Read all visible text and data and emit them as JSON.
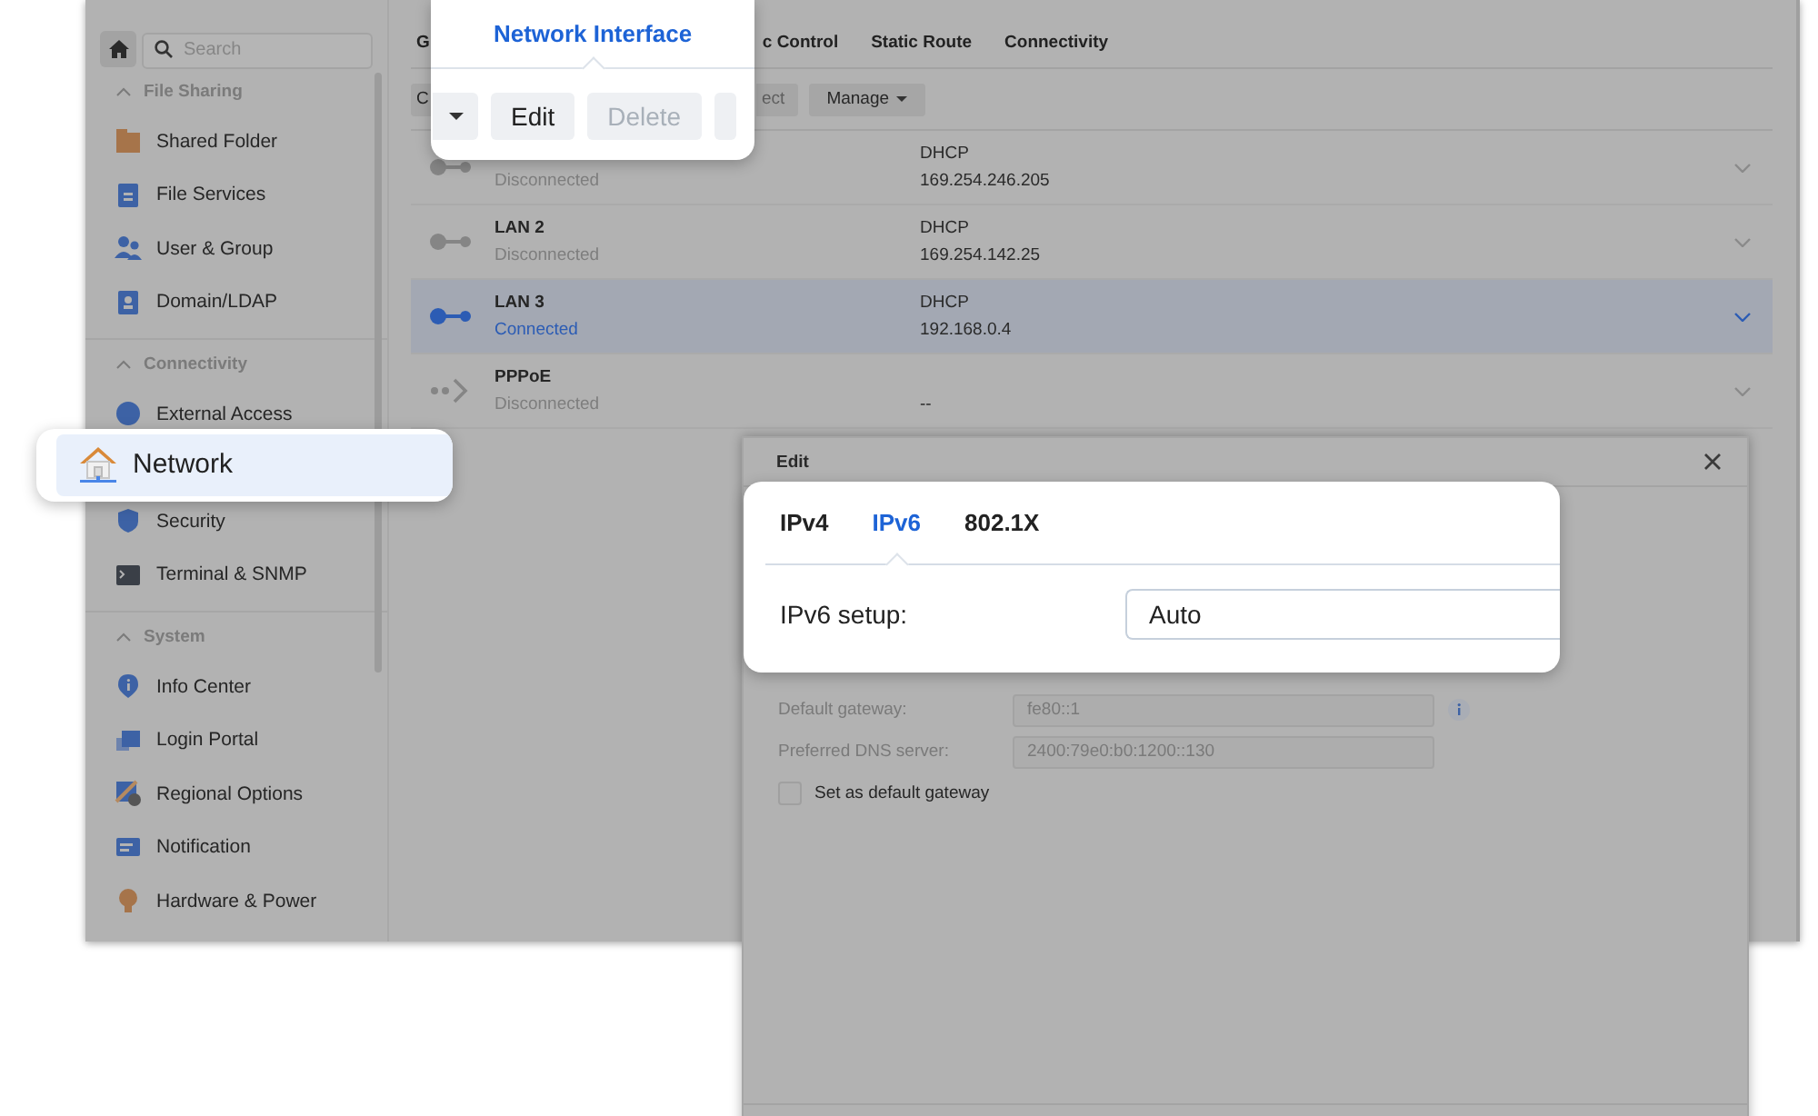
{
  "window": {
    "sidebar": {
      "search": {
        "placeholder": "Search"
      },
      "sections": [
        {
          "title": "File Sharing",
          "expanded": true,
          "items": [
            {
              "label": "Shared Folder",
              "selected": false
            },
            {
              "label": "File Services",
              "selected": false
            },
            {
              "label": "User & Group",
              "selected": false
            },
            {
              "label": "Domain/LDAP",
              "selected": false
            }
          ]
        },
        {
          "title": "Connectivity",
          "expanded": true,
          "items": [
            {
              "label": "External Access",
              "selected": false
            },
            {
              "label": "Network",
              "selected": true,
              "zoomed": true
            },
            {
              "label": "Security",
              "selected": false
            },
            {
              "label": "Terminal & SNMP",
              "selected": false
            }
          ]
        },
        {
          "title": "System",
          "expanded": true,
          "items": [
            {
              "label": "Info Center",
              "selected": false
            },
            {
              "label": "Login Portal",
              "selected": false
            },
            {
              "label": "Regional Options",
              "selected": false
            },
            {
              "label": "Notification",
              "selected": false
            },
            {
              "label": "Hardware & Power",
              "selected": false
            }
          ]
        }
      ]
    },
    "tabs": [
      {
        "label": "G"
      },
      {
        "label": "c Control"
      },
      {
        "label": "Static Route"
      },
      {
        "label": "Connectivity"
      }
    ],
    "toolbar": [
      {
        "label": "C",
        "disabled": false
      },
      {
        "label": "ect",
        "disabled": true
      },
      {
        "label": "Manage",
        "disabled": false,
        "dropdown": true
      }
    ],
    "interfaces": [
      {
        "kind": "lan",
        "status": "Disconnected",
        "connected": false,
        "mode": "DHCP",
        "address": "169.254.246.205",
        "selected": false
      },
      {
        "kind": "lan",
        "name": "LAN 2",
        "status": "Disconnected",
        "connected": false,
        "mode": "DHCP",
        "address": "169.254.142.25",
        "selected": false
      },
      {
        "kind": "lan",
        "name": "LAN 3",
        "status": "Connected",
        "connected": true,
        "mode": "DHCP",
        "address": "192.168.0.4",
        "selected": true
      },
      {
        "kind": "pppoe",
        "name": "PPPoE",
        "status": "Disconnected",
        "connected": false,
        "address": "--",
        "selected": false
      }
    ]
  },
  "toolbar_zoom": {
    "title": "Network Interface",
    "buttons": [
      {
        "kind": "caret"
      },
      {
        "kind": "text",
        "label": "Edit",
        "disabled": false
      },
      {
        "kind": "text",
        "label": "Delete",
        "disabled": true
      },
      {
        "kind": "blank"
      }
    ]
  },
  "edit_dialog": {
    "title": "Edit",
    "zoom_panel": {
      "tabs": [
        {
          "label": "IPv4",
          "selected": false
        },
        {
          "label": "IPv6",
          "selected": true
        },
        {
          "label": "802.1X",
          "selected": false
        }
      ],
      "field": {
        "label": "IPv6 setup:",
        "value": "Auto"
      }
    },
    "fields": [
      {
        "label": "Default gateway:",
        "value": "fe80::1",
        "info": true,
        "disabled": true
      },
      {
        "label": "Preferred DNS server:",
        "value": "2400:79e0:b0:1200::130",
        "disabled": true
      }
    ],
    "checkbox": {
      "label": "Set as default gateway",
      "checked": false
    }
  }
}
